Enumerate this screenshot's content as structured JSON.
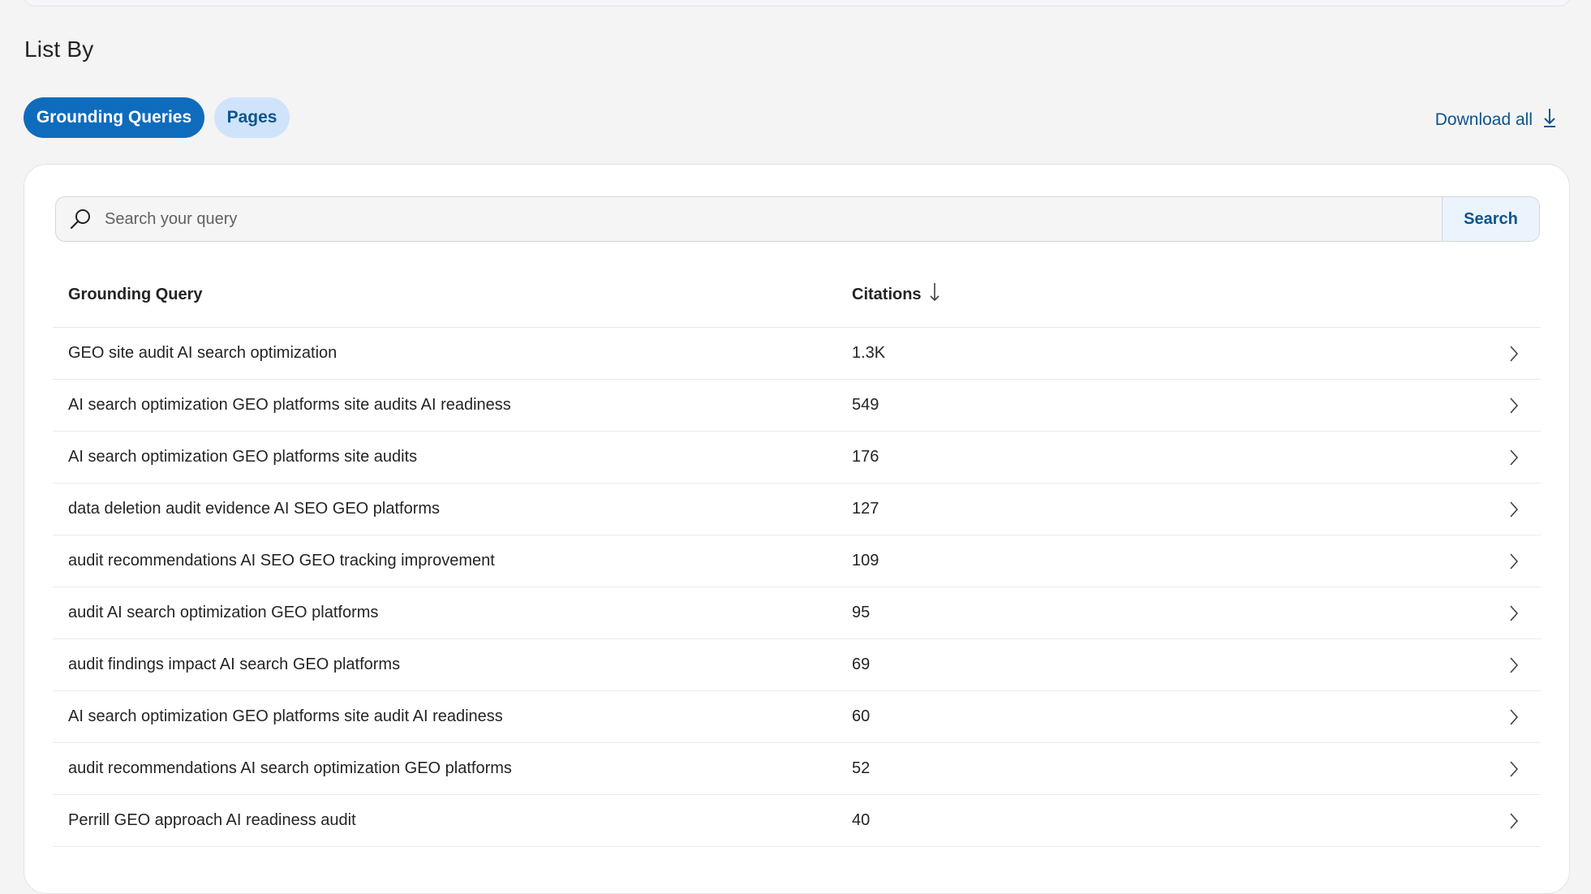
{
  "section": {
    "title": "List By"
  },
  "tabs": [
    {
      "label": "Grounding Queries",
      "active": true
    },
    {
      "label": "Pages",
      "active": false
    }
  ],
  "download": {
    "label": "Download all",
    "icon": "download-arrow-icon"
  },
  "search": {
    "placeholder": "Search your query",
    "value": "",
    "button_label": "Search",
    "icon": "search-icon"
  },
  "table": {
    "columns": {
      "query": "Grounding Query",
      "citations": "Citations",
      "sort": "descending"
    },
    "rows": [
      {
        "query": "GEO site audit AI search optimization",
        "citations": "1.3K"
      },
      {
        "query": "AI search optimization GEO platforms site audits AI readiness",
        "citations": "549"
      },
      {
        "query": "AI search optimization GEO platforms site audits",
        "citations": "176"
      },
      {
        "query": "data deletion audit evidence AI SEO GEO platforms",
        "citations": "127"
      },
      {
        "query": "audit recommendations AI SEO GEO tracking improvement",
        "citations": "109"
      },
      {
        "query": "audit AI search optimization GEO platforms",
        "citations": "95"
      },
      {
        "query": "audit findings impact AI search GEO platforms",
        "citations": "69"
      },
      {
        "query": "AI search optimization GEO platforms site audit AI readiness",
        "citations": "60"
      },
      {
        "query": "audit recommendations AI search optimization GEO platforms",
        "citations": "52"
      },
      {
        "query": "Perrill GEO approach AI readiness audit",
        "citations": "40"
      }
    ]
  },
  "colors": {
    "accent": "#0f6cbd",
    "accent_light": "#cfe4fa",
    "link": "#0f548c",
    "background": "#f4f4f4"
  }
}
